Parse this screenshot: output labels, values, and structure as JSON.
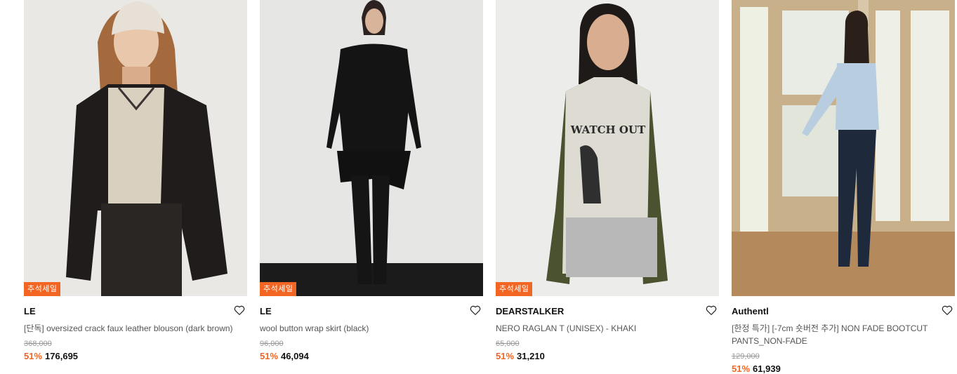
{
  "products": [
    {
      "badge": "추석세일",
      "brand": "LE",
      "name": "[단독] oversized crack faux leather blouson (dark brown)",
      "original_price": "368,000",
      "discount": "51%",
      "price": "176,695"
    },
    {
      "badge": "추석세일",
      "brand": "LE",
      "name": "wool button wrap skirt (black)",
      "original_price": "96,000",
      "discount": "51%",
      "price": "46,094"
    },
    {
      "badge": "추석세일",
      "brand": "DEARSTALKER",
      "name": "NERO RAGLAN T (UNISEX) - KHAKI",
      "original_price": "65,000",
      "discount": "51%",
      "price": "31,210"
    },
    {
      "brand": "Authentl",
      "name": "[한정 특가] [-7cm 숏버전 추가] NON FADE BOOTCUT PANTS_NON-FADE",
      "original_price": "129,000",
      "discount": "51%",
      "price": "61,939"
    }
  ],
  "colors": {
    "accent": "#f26522",
    "text": "#111111",
    "muted": "#555555"
  },
  "icons": {
    "wishlist": "heart-outline-icon"
  }
}
